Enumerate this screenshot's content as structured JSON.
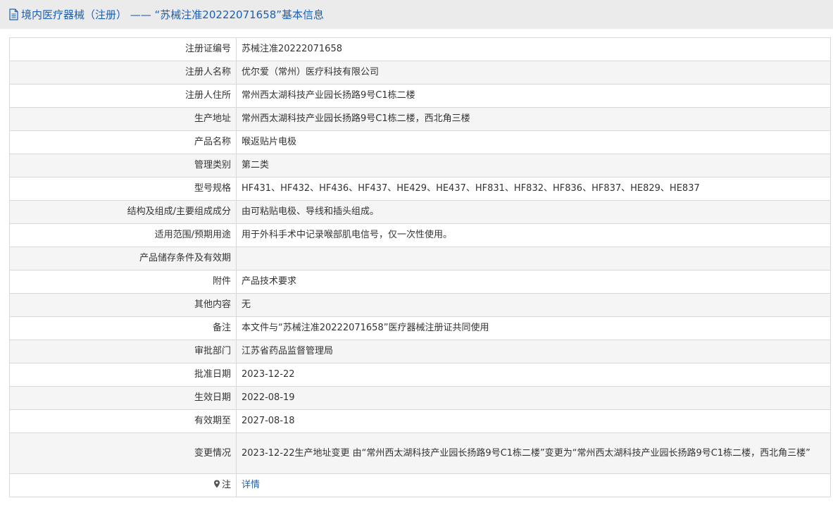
{
  "header": {
    "title": "境内医疗器械（注册） —— “苏械注准20222071658”基本信息",
    "icon": "document-icon"
  },
  "rows": [
    {
      "label": "注册证编号",
      "value": "苏械注准20222071658"
    },
    {
      "label": "注册人名称",
      "value": "优尔爱（常州）医疗科技有限公司"
    },
    {
      "label": "注册人住所",
      "value": "常州西太湖科技产业园长扬路9号C1栋二楼"
    },
    {
      "label": "生产地址",
      "value": "常州西太湖科技产业园长扬路9号C1栋二楼，西北角三楼"
    },
    {
      "label": "产品名称",
      "value": "喉返贴片电极"
    },
    {
      "label": "管理类别",
      "value": "第二类"
    },
    {
      "label": "型号规格",
      "value": "HF431、HF432、HF436、HF437、HE429、HE437、HF831、HF832、HF836、HF837、HE829、HE837"
    },
    {
      "label": "结构及组成/主要组成成分",
      "value": "由可粘贴电极、导线和插头组成。"
    },
    {
      "label": "适用范围/预期用途",
      "value": "用于外科手术中记录喉部肌电信号，仅一次性使用。"
    },
    {
      "label": "产品储存条件及有效期",
      "value": ""
    },
    {
      "label": "附件",
      "value": "产品技术要求"
    },
    {
      "label": "其他内容",
      "value": "无"
    },
    {
      "label": "备注",
      "value": "本文件与“苏械注准20222071658”医疗器械注册证共同使用"
    },
    {
      "label": "审批部门",
      "value": "江苏省药品监督管理局"
    },
    {
      "label": "批准日期",
      "value": "2023-12-22"
    },
    {
      "label": "生效日期",
      "value": "2022-08-19"
    },
    {
      "label": "有效期至",
      "value": "2027-08-18"
    },
    {
      "label": "变更情况",
      "value": "2023-12-22生产地址变更 由“常州西太湖科技产业园长扬路9号C1栋二楼”变更为“常州西太湖科技产业园长扬路9号C1栋二楼，西北角三楼”"
    }
  ],
  "note": {
    "label": "注",
    "icon": "pin-icon",
    "link": "详情"
  },
  "colors": {
    "accent": "#1a5fb4",
    "header_bg": "#ebebeb",
    "alt_row_bg": "#f5f5f5",
    "border": "#d8d8d8"
  }
}
